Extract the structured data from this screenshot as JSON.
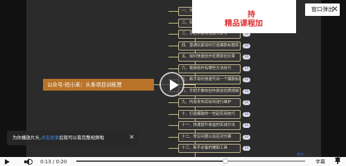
{
  "mindmap": {
    "root": "公众号-招小来：头条项目训练营",
    "nodes": [
      {
        "label": "一、头条项目基本介绍",
        "badge": ""
      },
      {
        "label": "二、如何选择一个适合的领域",
        "badge": ""
      },
      {
        "label": "三、手把手教你注册头条号",
        "badge": "11"
      },
      {
        "label": "四、普通玩家如何打造爆款标题库",
        "badge": "11"
      },
      {
        "label": "五、如何快速创作优质原创文章",
        "badge": "11"
      },
      {
        "label": "六、视频创作有哪些方法技巧",
        "badge": "11"
      },
      {
        "label": "七、新手如何快速写出一个爆款标题",
        "badge": "11"
      },
      {
        "label": "八、手把手教你创作原创优质视频",
        "badge": "11"
      },
      {
        "label": "九、内容发布后如何进行维护",
        "badge": "11"
      },
      {
        "label": "十、打造爆款的一些起实用技巧",
        "badge": "11"
      },
      {
        "label": "十一、快速提升收益的实战方法",
        "badge": "11"
      },
      {
        "label": "十二、常见问题以及应对方案",
        "badge": "11"
      },
      {
        "label": "十三、新手必备的辅助工具",
        "badge": "11"
      }
    ]
  },
  "promo": {
    "line1": "持",
    "line2": "精品课程加"
  },
  "popout": {
    "label": "窗口弹出",
    "close": "✕"
  },
  "toast": {
    "prefix": "为你播放片头,",
    "link": "点击登录",
    "suffix": "后就可以看完整视频啦",
    "close": "✕"
  },
  "watermark": "微信：...",
  "controls": {
    "current_time": "0:13",
    "separator": "/",
    "duration": "0:20",
    "progress": 0.65,
    "captions": "字幕"
  }
}
